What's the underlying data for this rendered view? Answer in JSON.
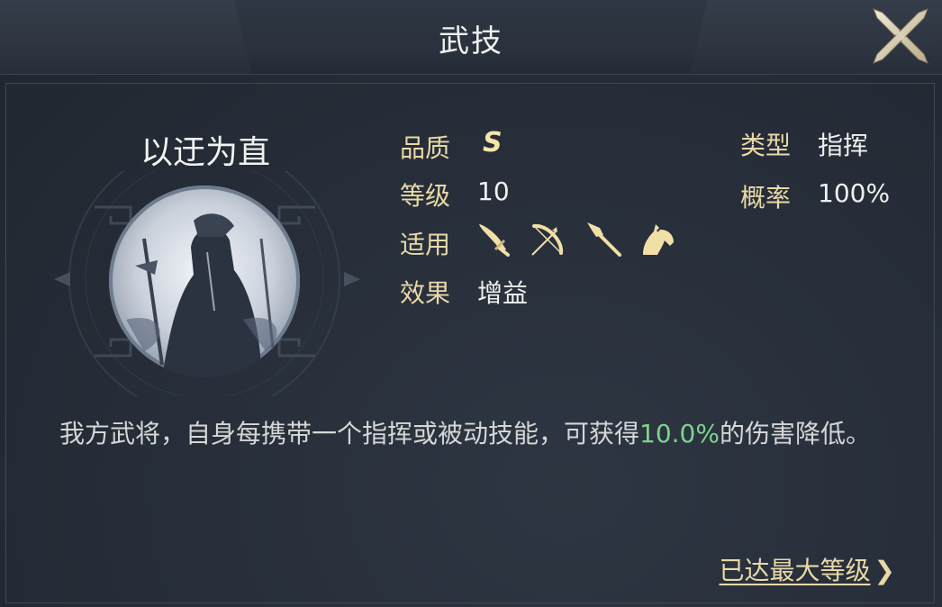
{
  "header": {
    "title": "武技"
  },
  "skill": {
    "name": "以迂为直",
    "quality_label": "品质",
    "quality_value": "S",
    "level_label": "等级",
    "level_value": "10",
    "applicable_label": "适用",
    "applicable_icons": [
      "sword-icon",
      "bow-icon",
      "spear-icon",
      "horse-icon"
    ],
    "effect_label": "效果",
    "effect_value": "增益",
    "type_label": "类型",
    "type_value": "指挥",
    "chance_label": "概率",
    "chance_value": "100%"
  },
  "description": {
    "part1": "我方武将，自身每携带一个指挥或被动技能，可获得",
    "highlight": "10.0%",
    "part2": "的伤害降低。"
  },
  "footer": {
    "max_level_link": "已达最大等级"
  },
  "colors": {
    "label_gold": "#e9d9a8",
    "highlight_green": "#7fd38a",
    "background": "#262d38"
  }
}
